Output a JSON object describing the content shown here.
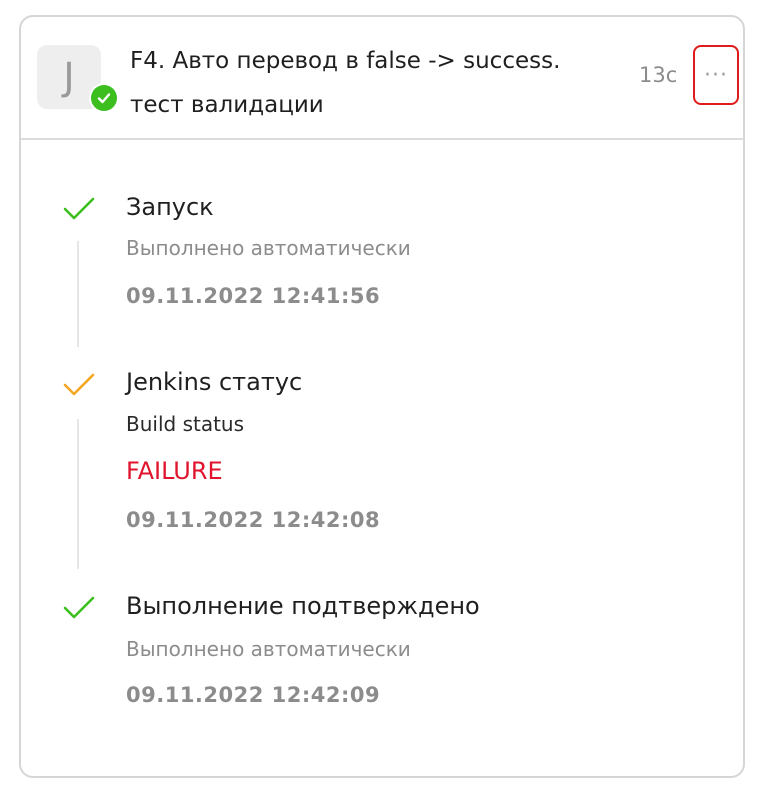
{
  "header": {
    "avatar_letter": "J",
    "title_line1": "F4. Авто перевод в false -> success.",
    "title_line2": "тест валидации",
    "duration": "13с",
    "more_label": "···"
  },
  "colors": {
    "success": "#3cbf1e",
    "warning": "#f5a623",
    "failure": "#e0142d",
    "highlight_box": "#e01b1b"
  },
  "steps": [
    {
      "status_icon": "check-green-icon",
      "title": "Запуск",
      "subtitle": "Выполнено автоматически",
      "timestamp": "09.11.2022 12:41:56"
    },
    {
      "status_icon": "check-orange-icon",
      "title": "Jenkins статус",
      "subtitle": "Build status",
      "status_value": "FAILURE",
      "timestamp": "09.11.2022 12:42:08"
    },
    {
      "status_icon": "check-green-icon",
      "title": "Выполнение подтверждено",
      "subtitle": "Выполнено автоматически",
      "timestamp": "09.11.2022 12:42:09"
    }
  ]
}
